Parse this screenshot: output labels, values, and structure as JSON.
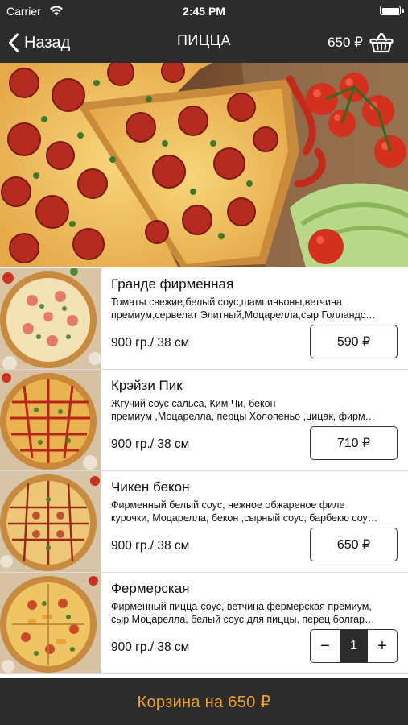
{
  "status_bar": {
    "carrier": "Carrier",
    "time": "2:45 PM"
  },
  "nav": {
    "back_label": "Назад",
    "title": "ПИЦЦА",
    "cart_amount": "650 ₽"
  },
  "products": [
    {
      "name": "Гранде фирменная",
      "desc_line1": "Томаты свежие,белый соус,шампиньоны,ветчина",
      "desc_line2": "премиум,сервелат Элитный,Моцарелла,сыр Голландс…",
      "size": "900 гр./ 38 см",
      "price": "590 ₽"
    },
    {
      "name": "Крэйзи Пик",
      "desc_line1": "Жгучий соус сальса, Ким Чи, бекон",
      "desc_line2": "премиум ,Моцарелла, перцы Холопеньо  ,цицак, фирм…",
      "size": "900 гр./ 38 см",
      "price": "710 ₽"
    },
    {
      "name": "Чикен бекон",
      "desc_line1": "Фирменный белый соус, нежное обжареное филе",
      "desc_line2": "курочки, Моцарелла, бекон ,сырный соус, барбекю соу…",
      "size": "900 гр./ 38 см",
      "price": "650 ₽"
    },
    {
      "name": "Фермерская",
      "desc_line1": "Фирменный пицца-соус, ветчина  фермерская премиум,",
      "desc_line2": "сыр Моцарелла, белый соус для пиццы, перец  болгар…",
      "size": "900 гр./ 38 см",
      "stepper": {
        "minus": "−",
        "quantity": "1",
        "plus": "+"
      }
    }
  ],
  "footer": {
    "cart_label": "Корзина на 650 ₽"
  },
  "colors": {
    "bar": "#2c2c2c",
    "accent": "#f0a030"
  },
  "icons": [
    "wifi-icon",
    "battery-icon",
    "chevron-left-icon",
    "basket-icon"
  ]
}
